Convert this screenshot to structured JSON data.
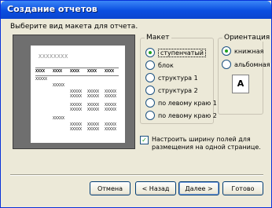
{
  "window": {
    "title": "Создание отчетов"
  },
  "prompt": "Выберите вид макета для отчета.",
  "preview": {
    "title_placeholder": "XXXXXXXX",
    "header_cells": [
      "XXXX",
      "XXXX",
      "XXXX",
      "XXXX",
      "XXXX"
    ],
    "cell": "XXXXX"
  },
  "layout": {
    "label": "Макет",
    "options": [
      "ступенчатый",
      "блок",
      "структура 1",
      "структура 2",
      "по левому краю 1",
      "по левому краю 2"
    ],
    "selected": "ступенчатый"
  },
  "orientation": {
    "label": "Ориентация",
    "options": [
      "книжная",
      "альбомная"
    ],
    "selected": "книжная",
    "icon_letter": "A"
  },
  "fit_fields": {
    "label": "Настроить ширину полей для размещения на одной странице.",
    "checked": true
  },
  "buttons": {
    "cancel": "Отмена",
    "back": "< Назад",
    "next": "Далее >",
    "finish": "Готово"
  }
}
